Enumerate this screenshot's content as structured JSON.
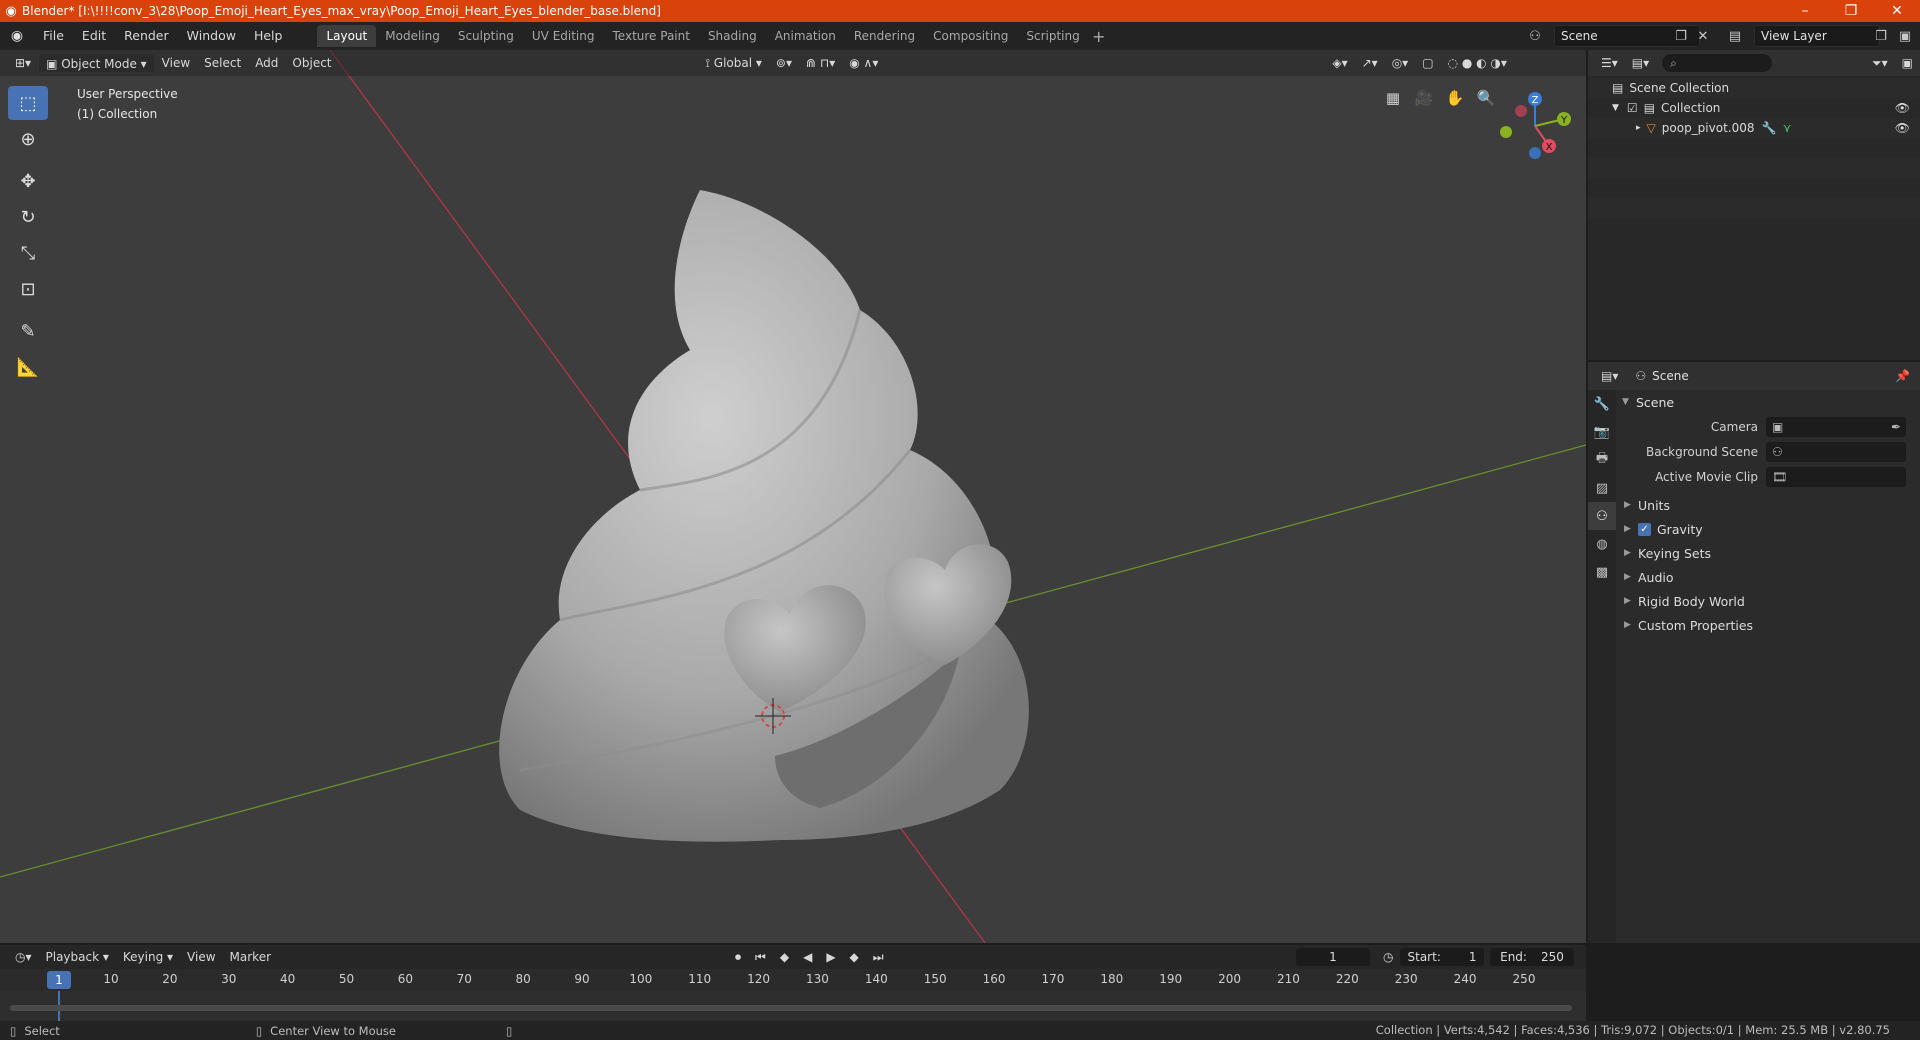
{
  "window": {
    "title": "Blender* [I:\\!!!!conv_3\\28\\Poop_Emoji_Heart_Eyes_max_vray\\Poop_Emoji_Heart_Eyes_blender_base.blend]",
    "minimize": "–",
    "maximize": "❐",
    "close": "✕"
  },
  "menu": [
    "File",
    "Edit",
    "Render",
    "Window",
    "Help"
  ],
  "workspaces": [
    "Layout",
    "Modeling",
    "Sculpting",
    "UV Editing",
    "Texture Paint",
    "Shading",
    "Animation",
    "Rendering",
    "Compositing",
    "Scripting"
  ],
  "workspace_add": "+",
  "scene_name": "Scene",
  "view_layer": "View Layer",
  "viewport": {
    "mode": "Object Mode",
    "menus": [
      "View",
      "Select",
      "Add",
      "Object"
    ],
    "transform": "Global",
    "info_line1": "User Perspective",
    "info_line2": "(1) Collection",
    "gizmo": {
      "z": "Z",
      "y": "Y",
      "x": "X"
    }
  },
  "outliner": {
    "rows": [
      {
        "label": "Scene Collection"
      },
      {
        "label": "Collection"
      },
      {
        "label": "poop_pivot.008"
      }
    ]
  },
  "properties": {
    "header": "Scene",
    "panel": "Scene",
    "fields": [
      {
        "label": "Camera"
      },
      {
        "label": "Background Scene"
      },
      {
        "label": "Active Movie Clip"
      }
    ],
    "subpanels": [
      "Units",
      "Gravity",
      "Keying Sets",
      "Audio",
      "Rigid Body World",
      "Custom Properties"
    ]
  },
  "timeline": {
    "menus": [
      "Playback",
      "Keying",
      "View",
      "Marker"
    ],
    "current_frame": "1",
    "start_label": "Start:",
    "start": "1",
    "end_label": "End:",
    "end": "250",
    "ticks": [
      "1",
      "10",
      "20",
      "30",
      "40",
      "50",
      "60",
      "70",
      "80",
      "90",
      "100",
      "110",
      "120",
      "130",
      "140",
      "150",
      "160",
      "170",
      "180",
      "190",
      "200",
      "210",
      "220",
      "230",
      "240",
      "250"
    ]
  },
  "status": {
    "left": "Select",
    "middle": "Center View to Mouse",
    "right": "Collection | Verts:4,542 | Faces:4,536 | Tris:9,072 | Objects:0/1 | Mem: 25.5 MB | v2.80.75"
  },
  "colors": {
    "accent": "#4772b3",
    "titlebar": "#d9420b",
    "x_axis": "#b3344a",
    "y_axis": "#6a8f2c"
  }
}
